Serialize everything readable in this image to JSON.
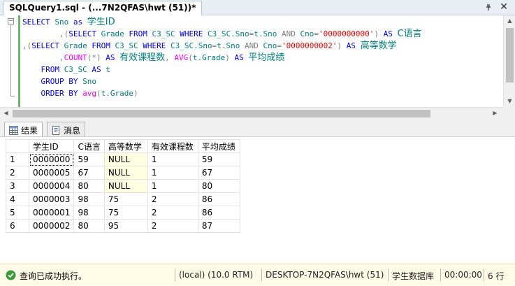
{
  "document_tab": {
    "title": "SQLQuery1.sql - (...7N2QFAS\\hwt (51))*"
  },
  "editor": {
    "lines": [
      [
        {
          "t": "SELECT ",
          "c": "kw"
        },
        {
          "t": "Sno ",
          "c": "id"
        },
        {
          "t": "as ",
          "c": "kw"
        },
        {
          "t": "学生ID",
          "c": "id cn"
        }
      ],
      [
        {
          "t": "        ,(",
          "c": "op"
        },
        {
          "t": "SELECT ",
          "c": "kw"
        },
        {
          "t": "Grade ",
          "c": "id"
        },
        {
          "t": "FROM ",
          "c": "kw"
        },
        {
          "t": "C3_SC ",
          "c": "id"
        },
        {
          "t": "WHERE ",
          "c": "kw"
        },
        {
          "t": "C3_SC.Sno",
          "c": "id"
        },
        {
          "t": "=",
          "c": "op"
        },
        {
          "t": "t.Sno ",
          "c": "id"
        },
        {
          "t": "AND ",
          "c": "op"
        },
        {
          "t": "Cno",
          "c": "id"
        },
        {
          "t": "=",
          "c": "op"
        },
        {
          "t": "'0000000000'",
          "c": "str"
        },
        {
          "t": ") ",
          "c": "op"
        },
        {
          "t": "AS ",
          "c": "kw"
        },
        {
          "t": "C语言",
          "c": "id cn"
        }
      ],
      [
        {
          "t": ",(",
          "c": "op"
        },
        {
          "t": "SELECT ",
          "c": "kw"
        },
        {
          "t": "Grade ",
          "c": "id"
        },
        {
          "t": "FROM ",
          "c": "kw"
        },
        {
          "t": "C3_SC ",
          "c": "id"
        },
        {
          "t": "WHERE ",
          "c": "kw"
        },
        {
          "t": "C3_SC.Sno",
          "c": "id"
        },
        {
          "t": "=",
          "c": "op"
        },
        {
          "t": "t.Sno ",
          "c": "id"
        },
        {
          "t": "AND ",
          "c": "op"
        },
        {
          "t": "Cno",
          "c": "id"
        },
        {
          "t": "=",
          "c": "op"
        },
        {
          "t": "'0000000002'",
          "c": "str"
        },
        {
          "t": ") ",
          "c": "op"
        },
        {
          "t": "AS ",
          "c": "kw"
        },
        {
          "t": "高等数学",
          "c": "id cn"
        }
      ],
      [
        {
          "t": "        ,",
          "c": "op"
        },
        {
          "t": "COUNT",
          "c": "fn"
        },
        {
          "t": "(*) ",
          "c": "op"
        },
        {
          "t": "AS ",
          "c": "kw"
        },
        {
          "t": "有效课程数",
          "c": "id cn"
        },
        {
          "t": ", ",
          "c": "op"
        },
        {
          "t": "AVG",
          "c": "fn"
        },
        {
          "t": "(",
          "c": "op"
        },
        {
          "t": "t.Grade",
          "c": "id"
        },
        {
          "t": ") ",
          "c": "op"
        },
        {
          "t": "AS ",
          "c": "kw"
        },
        {
          "t": "平均成绩",
          "c": "id cn"
        }
      ],
      [
        {
          "t": "    FROM ",
          "c": "kw"
        },
        {
          "t": "C3_SC ",
          "c": "id"
        },
        {
          "t": "AS ",
          "c": "kw"
        },
        {
          "t": "t",
          "c": "id"
        }
      ],
      [
        {
          "t": "    GROUP BY ",
          "c": "kw"
        },
        {
          "t": "Sno",
          "c": "id"
        }
      ],
      [
        {
          "t": "    ORDER BY ",
          "c": "kw"
        },
        {
          "t": "avg",
          "c": "fn"
        },
        {
          "t": "(",
          "c": "op"
        },
        {
          "t": "t.Grade",
          "c": "id"
        },
        {
          "t": ")",
          "c": "op"
        }
      ]
    ]
  },
  "result_tabs": {
    "results_label": "结果",
    "messages_label": "消息"
  },
  "grid": {
    "columns": [
      "",
      "学生ID",
      "C语言",
      "高等数学",
      "有效课程数",
      "平均成绩"
    ],
    "rows": [
      [
        "1",
        "0000000",
        "59",
        "NULL",
        "1",
        "59"
      ],
      [
        "2",
        "0000005",
        "67",
        "NULL",
        "1",
        "67"
      ],
      [
        "3",
        "0000004",
        "80",
        "NULL",
        "1",
        "80"
      ],
      [
        "4",
        "0000003",
        "98",
        "75",
        "2",
        "86"
      ],
      [
        "5",
        "0000001",
        "98",
        "75",
        "2",
        "86"
      ],
      [
        "6",
        "0000002",
        "80",
        "95",
        "2",
        "87"
      ]
    ]
  },
  "status": {
    "message": "查询已成功执行。",
    "server": "(local) (10.0 RTM)",
    "connection": "DESKTOP-7N2QFAS\\hwt (51)",
    "database": "学生数据库",
    "elapsed": "00:00:00",
    "rows": "6 行"
  },
  "colors": {
    "keyword": "#0000ff",
    "string": "#ff0000",
    "function": "#ff00ff",
    "identifier": "#008080",
    "null_cell": "#ffffe1",
    "status_bg": "#fffbe6"
  }
}
